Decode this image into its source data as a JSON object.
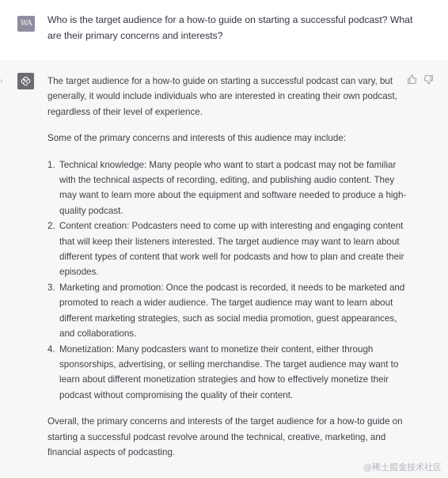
{
  "user": {
    "avatar_text": "WA",
    "message": "Who is the target audience for a how-to guide on starting a successful podcast? What are their primary concerns and interests?"
  },
  "assistant": {
    "avatar_icon": "openai-logo-icon",
    "intro": "The target audience for a how-to guide on starting a successful podcast can vary, but generally, it would include individuals who are interested in creating their own podcast, regardless of their level of experience.",
    "lead": "Some of the primary concerns and interests of this audience may include:",
    "items": [
      {
        "num": "1.",
        "text": "Technical knowledge: Many people who want to start a podcast may not be familiar with the technical aspects of recording, editing, and publishing audio content. They may want to learn more about the equipment and software needed to produce a high-quality podcast."
      },
      {
        "num": "2.",
        "text": "Content creation: Podcasters need to come up with interesting and engaging content that will keep their listeners interested. The target audience may want to learn about different types of content that work well for podcasts and how to plan and create their episodes."
      },
      {
        "num": "3.",
        "text": "Marketing and promotion: Once the podcast is recorded, it needs to be marketed and promoted to reach a wider audience. The target audience may want to learn about different marketing strategies, such as social media promotion, guest appearances, and collaborations."
      },
      {
        "num": "4.",
        "text": "Monetization: Many podcasters want to monetize their content, either through sponsorships, advertising, or selling merchandise. The target audience may want to learn about different monetization strategies and how to effectively monetize their podcast without compromising the quality of their content."
      }
    ],
    "conclusion": "Overall, the primary concerns and interests of the target audience for a how-to guide on starting a successful podcast revolve around the technical, creative, marketing, and financial aspects of podcasting."
  },
  "feedback": {
    "thumbs_up_icon": "thumbs-up-icon",
    "thumbs_down_icon": "thumbs-down-icon"
  },
  "watermark": "@稀土掘金技术社区",
  "colors": {
    "assistant_bg": "#f7f7f8",
    "user_bg": "#ffffff",
    "text": "#374151",
    "avatar_bg": "#8e8ea0"
  }
}
